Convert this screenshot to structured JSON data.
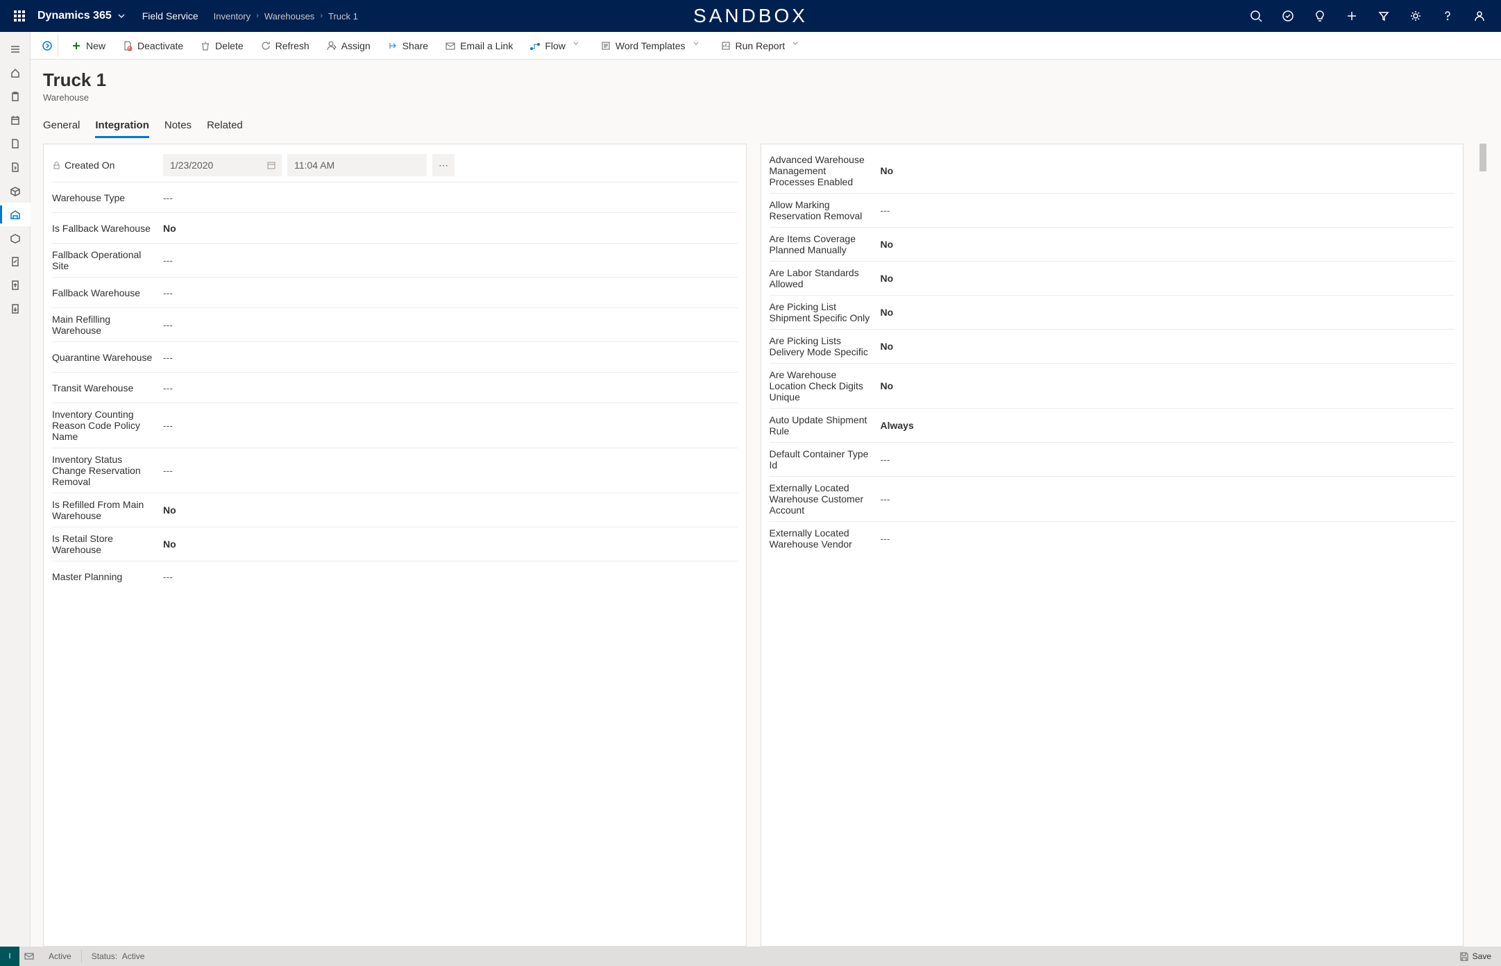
{
  "header": {
    "app_name": "Dynamics 365",
    "module": "Field Service",
    "breadcrumbs": [
      "Inventory",
      "Warehouses",
      "Truck 1"
    ],
    "sandbox_label": "SANDBOX"
  },
  "commands": {
    "new": "New",
    "deactivate": "Deactivate",
    "delete": "Delete",
    "refresh": "Refresh",
    "assign": "Assign",
    "share": "Share",
    "email_link": "Email a Link",
    "flow": "Flow",
    "word_templates": "Word Templates",
    "run_report": "Run Report"
  },
  "page": {
    "title": "Truck 1",
    "subtitle": "Warehouse"
  },
  "tabs": [
    "General",
    "Integration",
    "Notes",
    "Related"
  ],
  "active_tab_index": 1,
  "left_fields": [
    {
      "label": "Created On",
      "type": "date",
      "date": "1/23/2020",
      "time": "11:04 AM",
      "locked": true
    },
    {
      "label": "Warehouse Type",
      "value": "---",
      "bold": false
    },
    {
      "label": "Is Fallback Warehouse",
      "value": "No",
      "bold": true
    },
    {
      "label": "Fallback Operational Site",
      "value": "---",
      "bold": false
    },
    {
      "label": "Fallback Warehouse",
      "value": "---",
      "bold": false
    },
    {
      "label": "Main Refilling Warehouse",
      "value": "---",
      "bold": false
    },
    {
      "label": "Quarantine Warehouse",
      "value": "---",
      "bold": false
    },
    {
      "label": "Transit Warehouse",
      "value": "---",
      "bold": false
    },
    {
      "label": "Inventory Counting Reason Code Policy Name",
      "value": "---",
      "bold": false
    },
    {
      "label": "Inventory Status Change Reservation Removal",
      "value": "---",
      "bold": false
    },
    {
      "label": "Is Refilled From Main Warehouse",
      "value": "No",
      "bold": true
    },
    {
      "label": "Is Retail Store Warehouse",
      "value": "No",
      "bold": true
    },
    {
      "label": "Master Planning",
      "value": "---",
      "bold": false
    }
  ],
  "right_fields": [
    {
      "label": "Advanced Warehouse Management Processes Enabled",
      "value": "No",
      "bold": true
    },
    {
      "label": "Allow Marking Reservation Removal",
      "value": "---",
      "bold": false
    },
    {
      "label": "Are Items Coverage Planned Manually",
      "value": "No",
      "bold": true
    },
    {
      "label": "Are Labor Standards Allowed",
      "value": "No",
      "bold": true
    },
    {
      "label": "Are Picking List Shipment Specific Only",
      "value": "No",
      "bold": true
    },
    {
      "label": "Are Picking Lists Delivery Mode Specific",
      "value": "No",
      "bold": true
    },
    {
      "label": "Are Warehouse Location Check Digits Unique",
      "value": "No",
      "bold": true
    },
    {
      "label": "Auto Update Shipment Rule",
      "value": "Always",
      "bold": true
    },
    {
      "label": "Default Container Type Id",
      "value": "---",
      "bold": false
    },
    {
      "label": "Externally Located Warehouse Customer Account",
      "value": "---",
      "bold": false
    },
    {
      "label": "Externally Located Warehouse Vendor",
      "value": "---",
      "bold": false
    }
  ],
  "status": {
    "active": "Active",
    "status_label": "Status:",
    "status_value": "Active",
    "save": "Save",
    "lettermark": "I"
  }
}
